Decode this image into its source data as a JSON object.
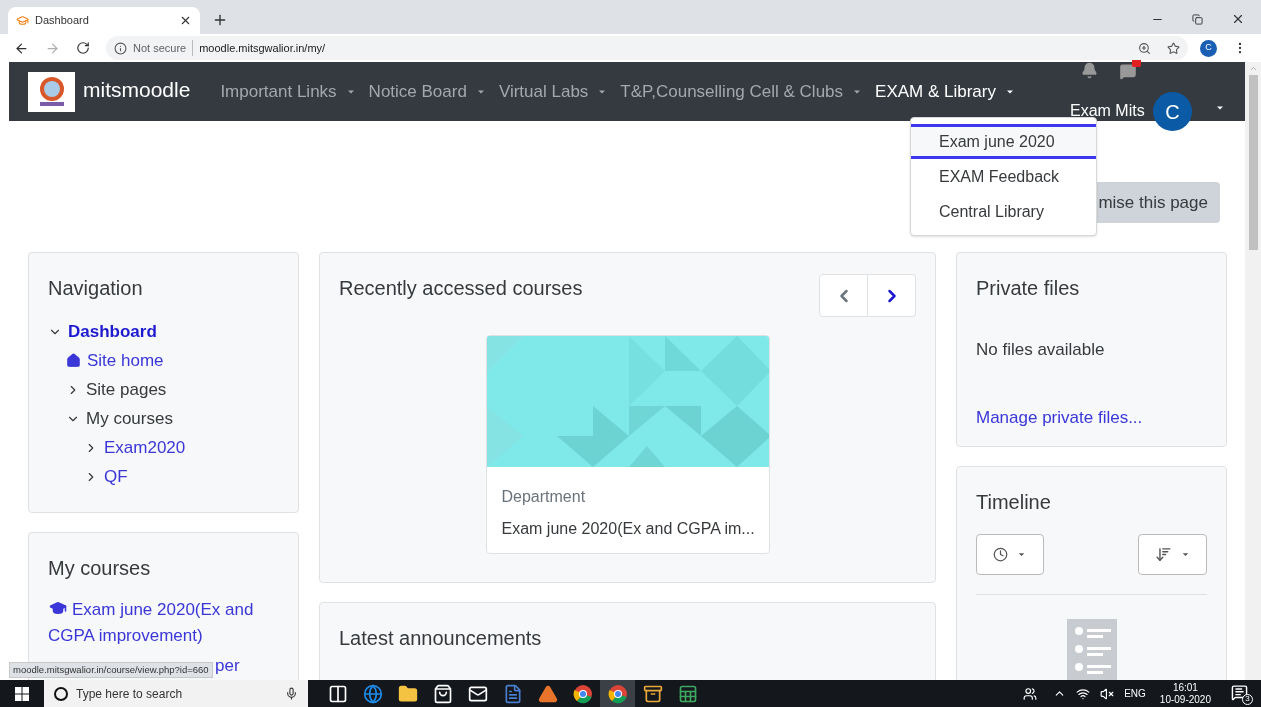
{
  "browser": {
    "tab": {
      "title": "Dashboard"
    },
    "address": {
      "security": "Not secure",
      "url": "moodle.mitsgwalior.in/my/"
    },
    "profile_initial": "C"
  },
  "navbar": {
    "brand": "mitsmoodle",
    "menus": [
      {
        "label": "Important Links",
        "selected": false
      },
      {
        "label": "Notice Board",
        "selected": false
      },
      {
        "label": "Virtual Labs",
        "selected": false
      },
      {
        "label": "T&P,Counselling Cell & Clubs",
        "selected": false
      },
      {
        "label": "EXAM & Library",
        "selected": true
      }
    ],
    "user_name": "Exam Mits",
    "avatar_initial": "C",
    "dropdown": [
      {
        "label": "Exam june 2020",
        "selected": true
      },
      {
        "label": "EXAM Feedback",
        "selected": false
      },
      {
        "label": "Central Library",
        "selected": false
      }
    ]
  },
  "customise_button": "mise this page",
  "navigation": {
    "title": "Navigation",
    "tree": [
      {
        "label": "Dashboard",
        "kind": "current",
        "expanded": true,
        "children": [
          {
            "label": "Site home",
            "kind": "home"
          },
          {
            "label": "Site pages",
            "kind": "branch",
            "expanded": false
          },
          {
            "label": "My courses",
            "kind": "branch",
            "expanded": true,
            "children": [
              {
                "label": "Exam2020",
                "kind": "course",
                "expanded": false
              },
              {
                "label": "QF",
                "kind": "course",
                "expanded": false
              }
            ]
          }
        ]
      }
    ]
  },
  "my_courses": {
    "title": "My courses",
    "items": [
      "Exam june 2020(Ex and CGPA improvement)",
      "per"
    ]
  },
  "recent": {
    "title": "Recently accessed courses",
    "prev_disabled": true,
    "next_disabled": false,
    "courses": [
      {
        "category": "Department",
        "name": "Exam june 2020(Ex and CGPA im..."
      }
    ]
  },
  "announcements": {
    "title": "Latest announcements"
  },
  "private_files": {
    "title": "Private files",
    "empty": "No files available",
    "link": "Manage private files..."
  },
  "timeline": {
    "title": "Timeline"
  },
  "status_url": "moodle.mitsgwalior.in/course/view.php?id=660",
  "taskbar": {
    "search_placeholder": "Type here to search",
    "apps": [
      {
        "kind": "taskview",
        "selected": false
      },
      {
        "kind": "edge",
        "selected": false
      },
      {
        "kind": "folder",
        "selected": false
      },
      {
        "kind": "store",
        "selected": false
      },
      {
        "kind": "mail",
        "selected": false
      },
      {
        "kind": "word",
        "selected": false
      },
      {
        "kind": "matlab",
        "selected": false
      },
      {
        "kind": "chrome",
        "selected": false
      },
      {
        "kind": "chrome",
        "selected": true
      },
      {
        "kind": "archive",
        "selected": false
      },
      {
        "kind": "excel",
        "selected": false
      }
    ],
    "language": "ENG",
    "time": "16:01",
    "date": "10-09-2020",
    "notifications": "3"
  }
}
